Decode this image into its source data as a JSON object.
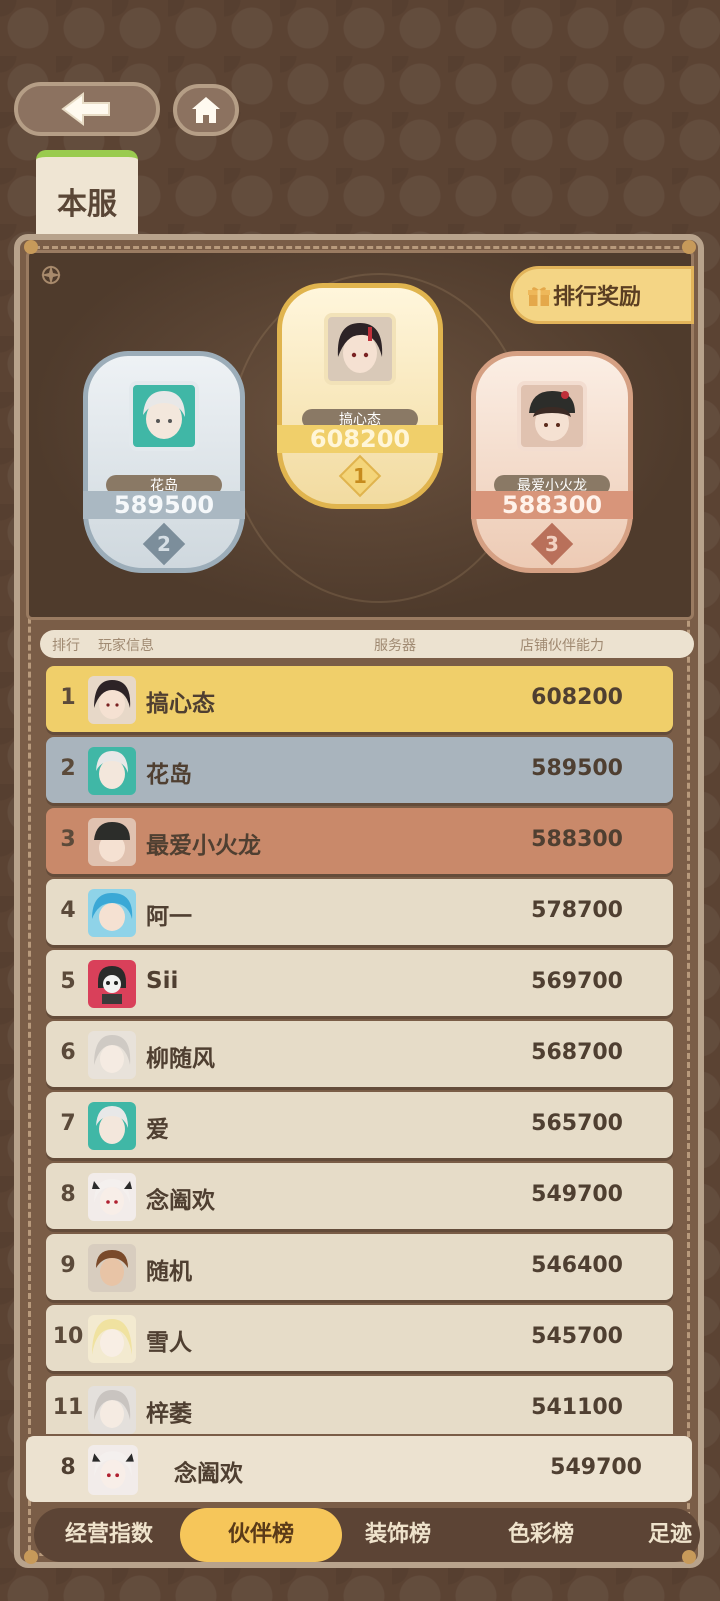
{
  "nav": {
    "back": "back",
    "home": "home"
  },
  "server_tab": {
    "label": "本服"
  },
  "reward_button": {
    "label": "排行奖励"
  },
  "podium": [
    {
      "rank": "1",
      "name": "搞心态",
      "score": "608200",
      "tier": "gold"
    },
    {
      "rank": "2",
      "name": "花岛",
      "score": "589500",
      "tier": "silver"
    },
    {
      "rank": "3",
      "name": "最爱小火龙",
      "score": "588300",
      "tier": "bronze"
    }
  ],
  "list_header": {
    "rank": "排行",
    "player": "玩家信息",
    "server": "服务器",
    "power": "店铺伙伴能力"
  },
  "rows": [
    {
      "rank": "1",
      "name": "搞心态",
      "score": "608200"
    },
    {
      "rank": "2",
      "name": "花岛",
      "score": "589500"
    },
    {
      "rank": "3",
      "name": "最爱小火龙",
      "score": "588300"
    },
    {
      "rank": "4",
      "name": "阿一",
      "score": "578700"
    },
    {
      "rank": "5",
      "name": "Sii",
      "score": "569700"
    },
    {
      "rank": "6",
      "name": "柳随风",
      "score": "568700"
    },
    {
      "rank": "7",
      "name": "爱",
      "score": "565700"
    },
    {
      "rank": "8",
      "name": "念阖欢",
      "score": "549700"
    },
    {
      "rank": "9",
      "name": "随机",
      "score": "546400"
    },
    {
      "rank": "10",
      "name": "雪人",
      "score": "545700"
    },
    {
      "rank": "11",
      "name": "梓萎",
      "score": "541100"
    }
  ],
  "my_row": {
    "rank": "8",
    "name": "念阖欢",
    "score": "549700"
  },
  "bottom_tabs": [
    {
      "label": "经营指数"
    },
    {
      "label": "伙伴榜"
    },
    {
      "label": "装饰榜"
    },
    {
      "label": "色彩榜"
    },
    {
      "label": "足迹"
    }
  ],
  "colors": {
    "gold": "#f0cf6a",
    "silver": "#a9b4bd",
    "bronze": "#c9896a",
    "default_row": "#e6dcc8"
  }
}
